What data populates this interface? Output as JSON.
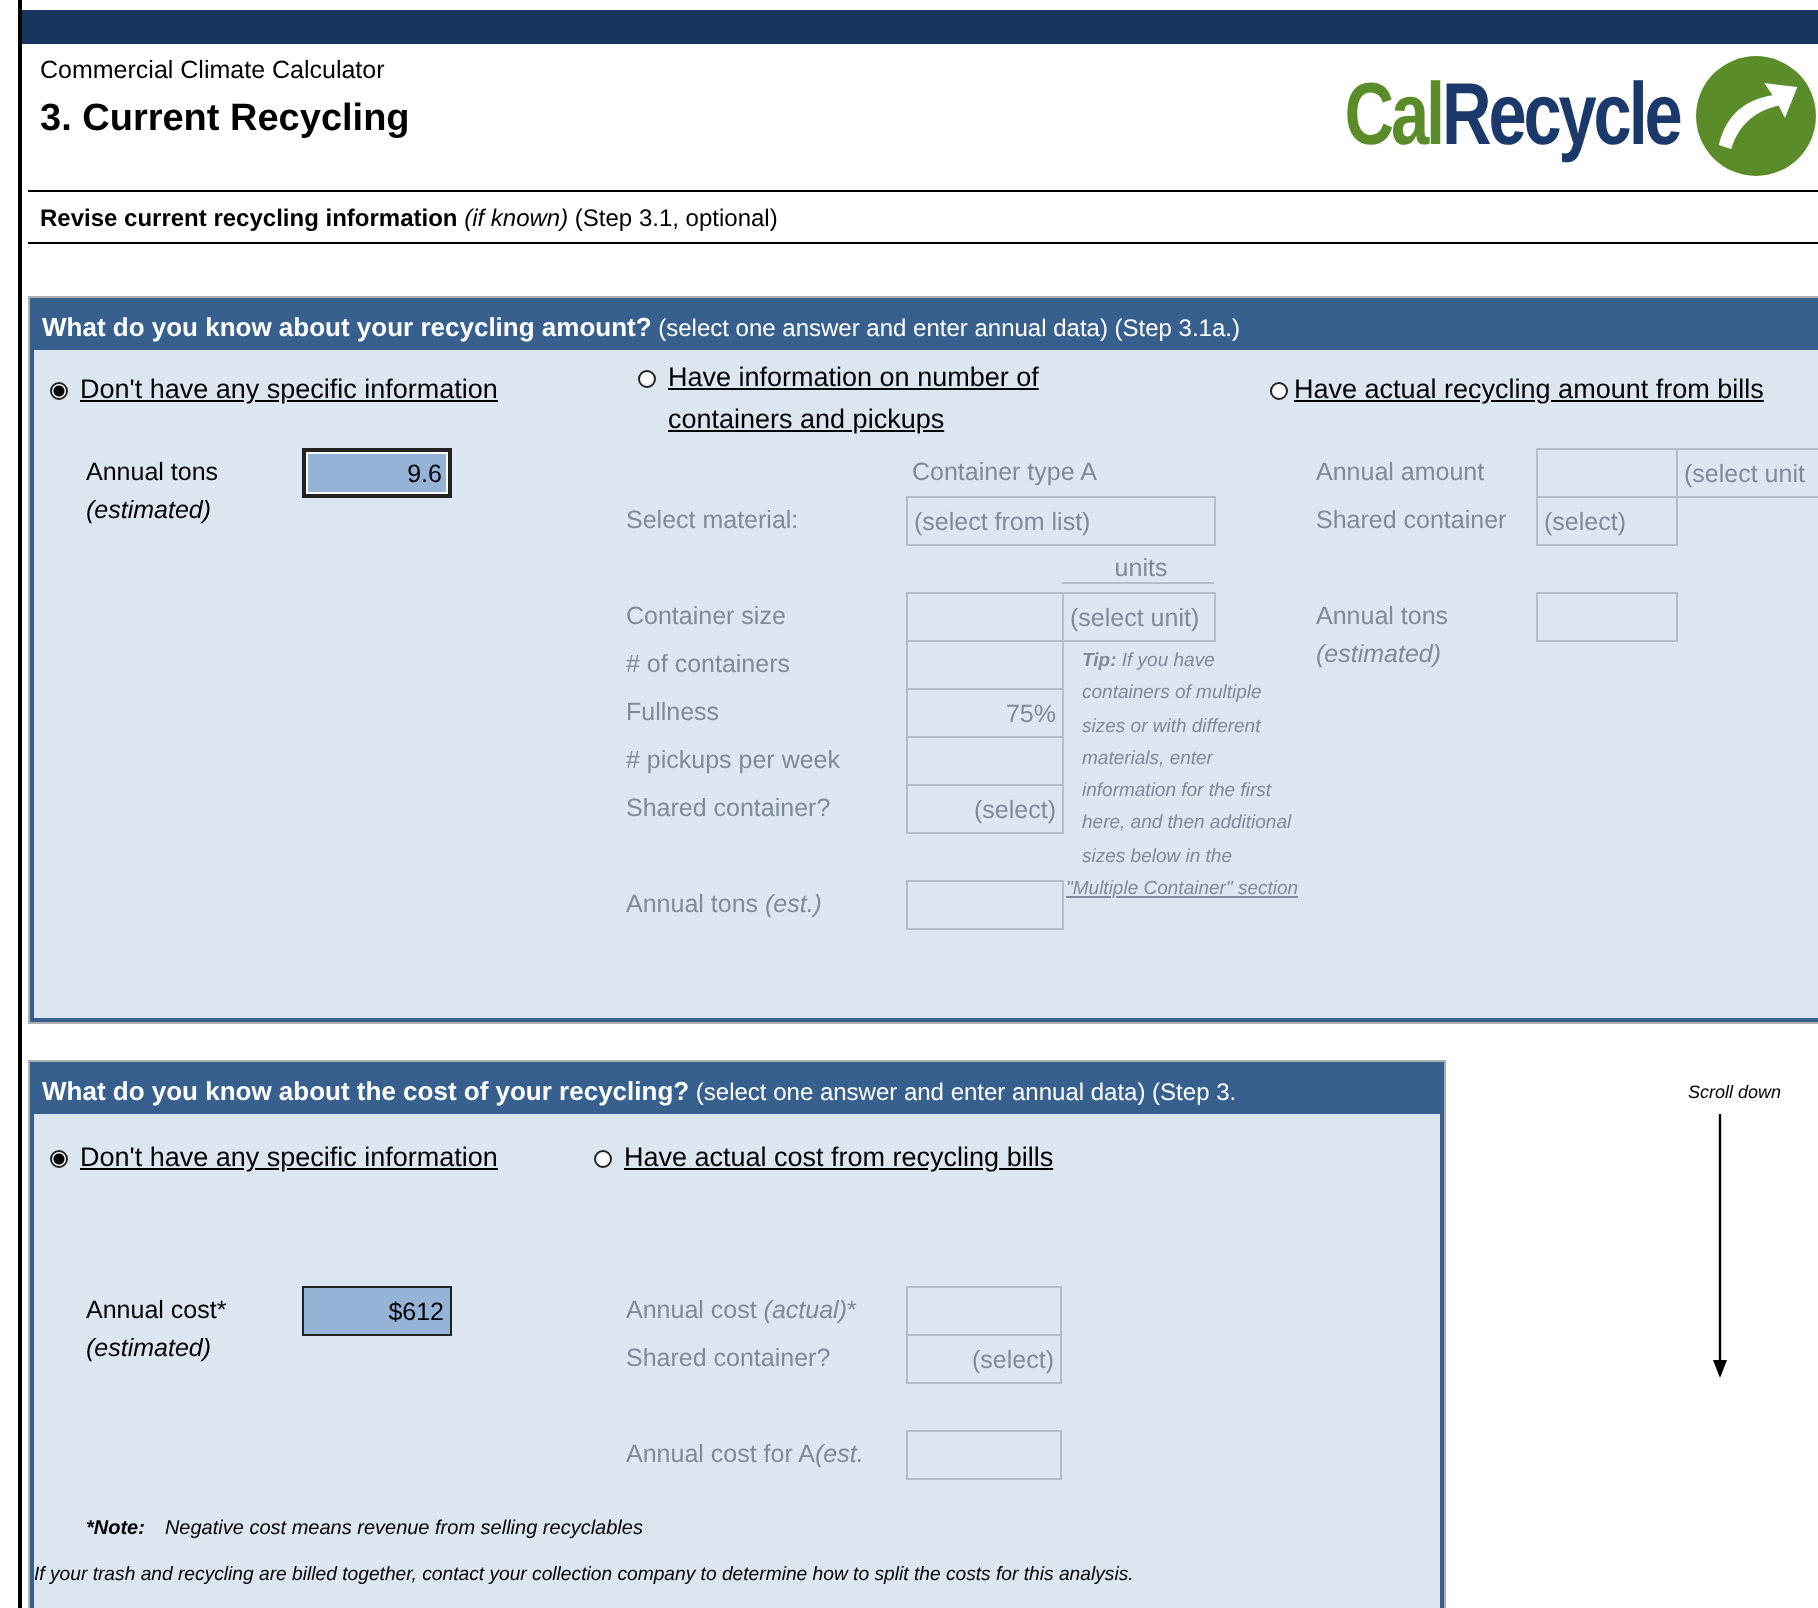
{
  "app_title": "Commercial Climate Calculator",
  "page_title": "3. Current Recycling",
  "logo": {
    "part_a": "Cal",
    "part_b": "Recycle"
  },
  "instruction": "**Revise current recycling information** *(if known)*  (Step 3.1, optional)",
  "sections": [
    {
      "heading": "What do you know about your recycling amount?",
      "heading_note": "(select one answer and enter annual data) (Step 3.1a.)",
      "options": [
        {
          "label": "Don't have any specific information",
          "selected": true,
          "disabled": false,
          "groups": [
            [
              {
                "kind": "field",
                "label": "Annual tons",
                "note": "(estimated)",
                "cells": [
                  {
                    "kind": "input",
                    "value": "9.6",
                    "focused": true
                  }
                ]
              }
            ]
          ]
        },
        {
          "label": "Have information on number of containers and pickups",
          "selected": false,
          "disabled": true,
          "groups": [
            [
              {
                "kind": "heading",
                "text": "Container type A"
              },
              {
                "kind": "field",
                "label": "Select material:",
                "cells": [
                  {
                    "kind": "wide_select",
                    "value": "(select from list)"
                  }
                ]
              },
              {
                "kind": "unit_heading",
                "text": "units"
              },
              {
                "kind": "field",
                "label": "Container size",
                "cells": [
                  {
                    "kind": "input"
                  },
                  {
                    "kind": "select",
                    "value": "(select unit)"
                  }
                ]
              },
              {
                "kind": "field",
                "label": "# of containers",
                "cells": [
                  {
                    "kind": "input"
                  }
                ]
              },
              {
                "kind": "field",
                "label": "Fullness",
                "cells": [
                  {
                    "kind": "input",
                    "value": "75%"
                  }
                ]
              },
              {
                "kind": "field",
                "label": "# pickups per week",
                "cells": [
                  {
                    "kind": "input"
                  }
                ]
              },
              {
                "kind": "field",
                "label": "Shared container?",
                "cells": [
                  {
                    "kind": "input",
                    "value": "(select)"
                  }
                ]
              }
            ],
            [
              {
                "kind": "field",
                "label": "Annual tons ",
                "label_em": "(est.)",
                "cells": [
                  {
                    "kind": "input"
                  }
                ]
              }
            ]
          ],
          "tip": {
            "label": "Tip:",
            "text": "If you have containers of multiple sizes or with different materials, enter information for the first here, and then additional sizes below in the",
            "link": "\"Multiple Container\" section"
          }
        },
        {
          "label": "Have actual recycling amount from bills",
          "selected": false,
          "disabled": true,
          "groups": [
            [
              {
                "kind": "field",
                "label": "Annual amount",
                "cells": [
                  {
                    "kind": "input"
                  },
                  {
                    "kind": "select",
                    "value": "(select unit"
                  }
                ]
              },
              {
                "kind": "field",
                "label": "Shared container",
                "cells": [
                  {
                    "kind": "select",
                    "value": "(select)"
                  }
                ]
              }
            ],
            [
              {
                "kind": "field",
                "label": "Annual tons",
                "note": "(estimated)",
                "cells": [
                  {
                    "kind": "input"
                  }
                ]
              }
            ]
          ]
        }
      ]
    },
    {
      "heading": "What do you know about the cost of your recycling?",
      "heading_note": "(select one answer and enter annual data) (Step 3.",
      "options": [
        {
          "label": "Don't have any specific information",
          "selected": true,
          "disabled": false,
          "groups": [
            [
              {
                "kind": "field",
                "label": "Annual cost*",
                "note": "(estimated)",
                "cells": [
                  {
                    "kind": "input",
                    "value": "$612"
                  }
                ]
              }
            ]
          ]
        },
        {
          "label": "Have actual cost from recycling bills",
          "selected": false,
          "disabled": true,
          "groups": [
            [
              {
                "kind": "field",
                "label": "Annual cost ",
                "label_em": "(actual)",
                "label_after": "*",
                "cells": [
                  {
                    "kind": "input"
                  }
                ]
              },
              {
                "kind": "field",
                "label": "Shared container?",
                "cells": [
                  {
                    "kind": "input",
                    "value": "(select)"
                  }
                ]
              }
            ],
            [
              {
                "kind": "field",
                "label": "Annual cost for A",
                "label_em": "(est.",
                "cells": [
                  {
                    "kind": "input"
                  }
                ]
              }
            ]
          ]
        }
      ],
      "notes": [
        {
          "label": "*Note:",
          "text": "Negative cost means revenue from selling recyclables"
        },
        {
          "text": "If your trash and recycling are billed together, contact your collection company to determine how to split the costs for this analysis."
        }
      ]
    }
  ],
  "scroll_hint": "Scroll down"
}
